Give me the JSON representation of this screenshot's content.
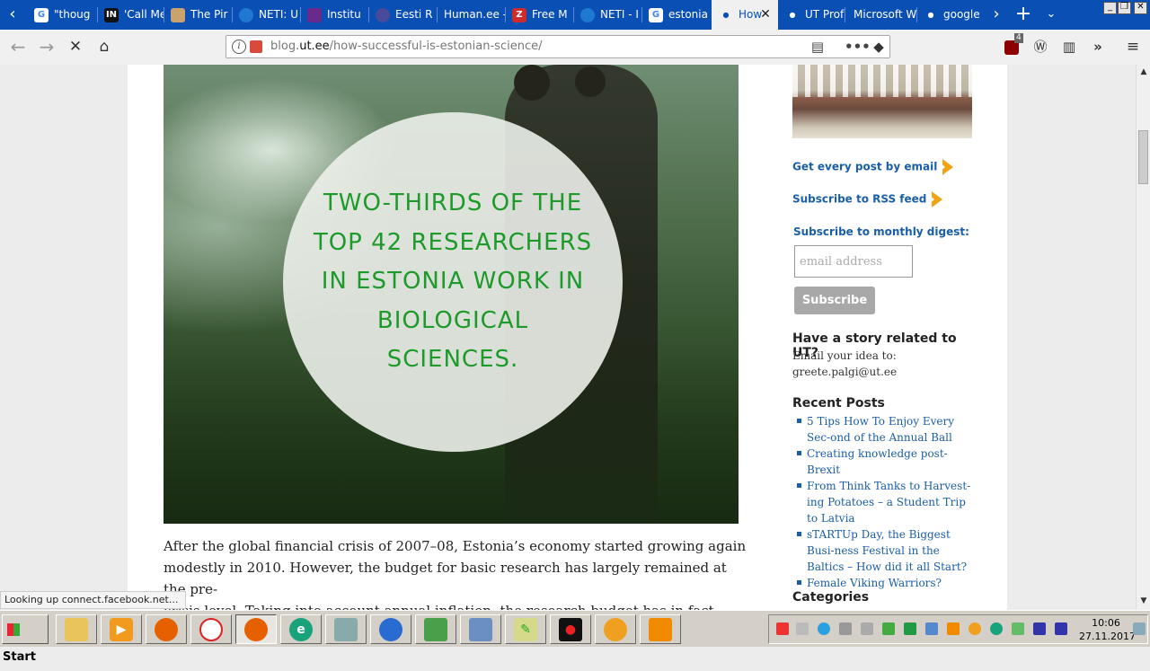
{
  "browser": {
    "tabs": [
      {
        "label": "\"thoug",
        "icon": "google-icon",
        "color": "#ffffff"
      },
      {
        "label": "'Call Me",
        "icon": "indesign-icon",
        "color": "#111111"
      },
      {
        "label": "The Pir",
        "icon": "pirate-icon",
        "color": "#c9a36b"
      },
      {
        "label": "NETI: U",
        "icon": "neti-icon",
        "color": "#1f78d1"
      },
      {
        "label": "Institu",
        "icon": "institute-icon",
        "color": "#6a2a8c"
      },
      {
        "label": "Eesti R",
        "icon": "eesti-icon",
        "color": "#4a4a9a"
      },
      {
        "label": "Human.ee -",
        "icon": "",
        "color": ""
      },
      {
        "label": "Free M",
        "icon": "zotero-icon",
        "color": "#d12a2a"
      },
      {
        "label": "NETI - I",
        "icon": "neti-icon",
        "color": "#1f78d1"
      },
      {
        "label": "estonia",
        "icon": "google-icon",
        "color": "#ffffff"
      },
      {
        "label": "How",
        "icon": "loading-icon",
        "color": ""
      },
      {
        "label": "UT Prof",
        "icon": "loading-icon",
        "color": ""
      },
      {
        "label": "Microsoft W",
        "icon": "",
        "color": ""
      },
      {
        "label": "google",
        "icon": "loading-icon",
        "color": ""
      }
    ],
    "active_tab_close": "✕",
    "url_domain_prefix": "blog.",
    "url_domain": "ut.ee",
    "url_path": "/how-successful-is-estonian-science/",
    "badge_count": "4",
    "status_text": "Looking up connect.facebook.net..."
  },
  "article": {
    "hero_lines": [
      "TWO-THIRDS OF THE",
      "TOP 42 RESEARCHERS",
      "IN ESTONIA WORK IN",
      "BIOLOGICAL",
      "SCIENCES."
    ],
    "body_lines": [
      "After the global financial crisis of 2007–08, Estonia’s economy started growing again",
      "modestly in 2010. However, the budget for basic research has largely remained at the pre-",
      "crisis level. Taking into account annual inflation, the research budget has in fact been"
    ]
  },
  "sidebar": {
    "email_link": "Get every post by email",
    "rss_link": "Subscribe to RSS feed",
    "digest_label": "Subscribe to monthly digest:",
    "email_placeholder": "email address",
    "subscribe_label": "Subscribe",
    "story_heading": "Have a story related to UT?",
    "story_text1": "Email your idea to:",
    "story_text2": "greete.palgi@ut.ee",
    "recent_heading": "Recent Posts",
    "recent_posts": [
      "5 Tips How To Enjoy Every Sec-ond of the Annual Ball",
      "Creating knowledge post-Brexit",
      "From Think Tanks to Harvest-ing Potatoes – a Student Trip to Latvia",
      "sTARTUp Day, the Biggest Busi-ness Festival in the Baltics – How did it all Start?",
      "Female Viking Warriors?"
    ],
    "categories_heading": "Categories"
  },
  "taskbar": {
    "start_label": "Start",
    "clock_time": "10:06",
    "clock_date": "27.11.2017"
  },
  "colors": {
    "tabstrip": "#0a4fb4",
    "link": "#1a5ea8",
    "hero_text": "#1d9a2a",
    "arrow": "#f2a314"
  }
}
